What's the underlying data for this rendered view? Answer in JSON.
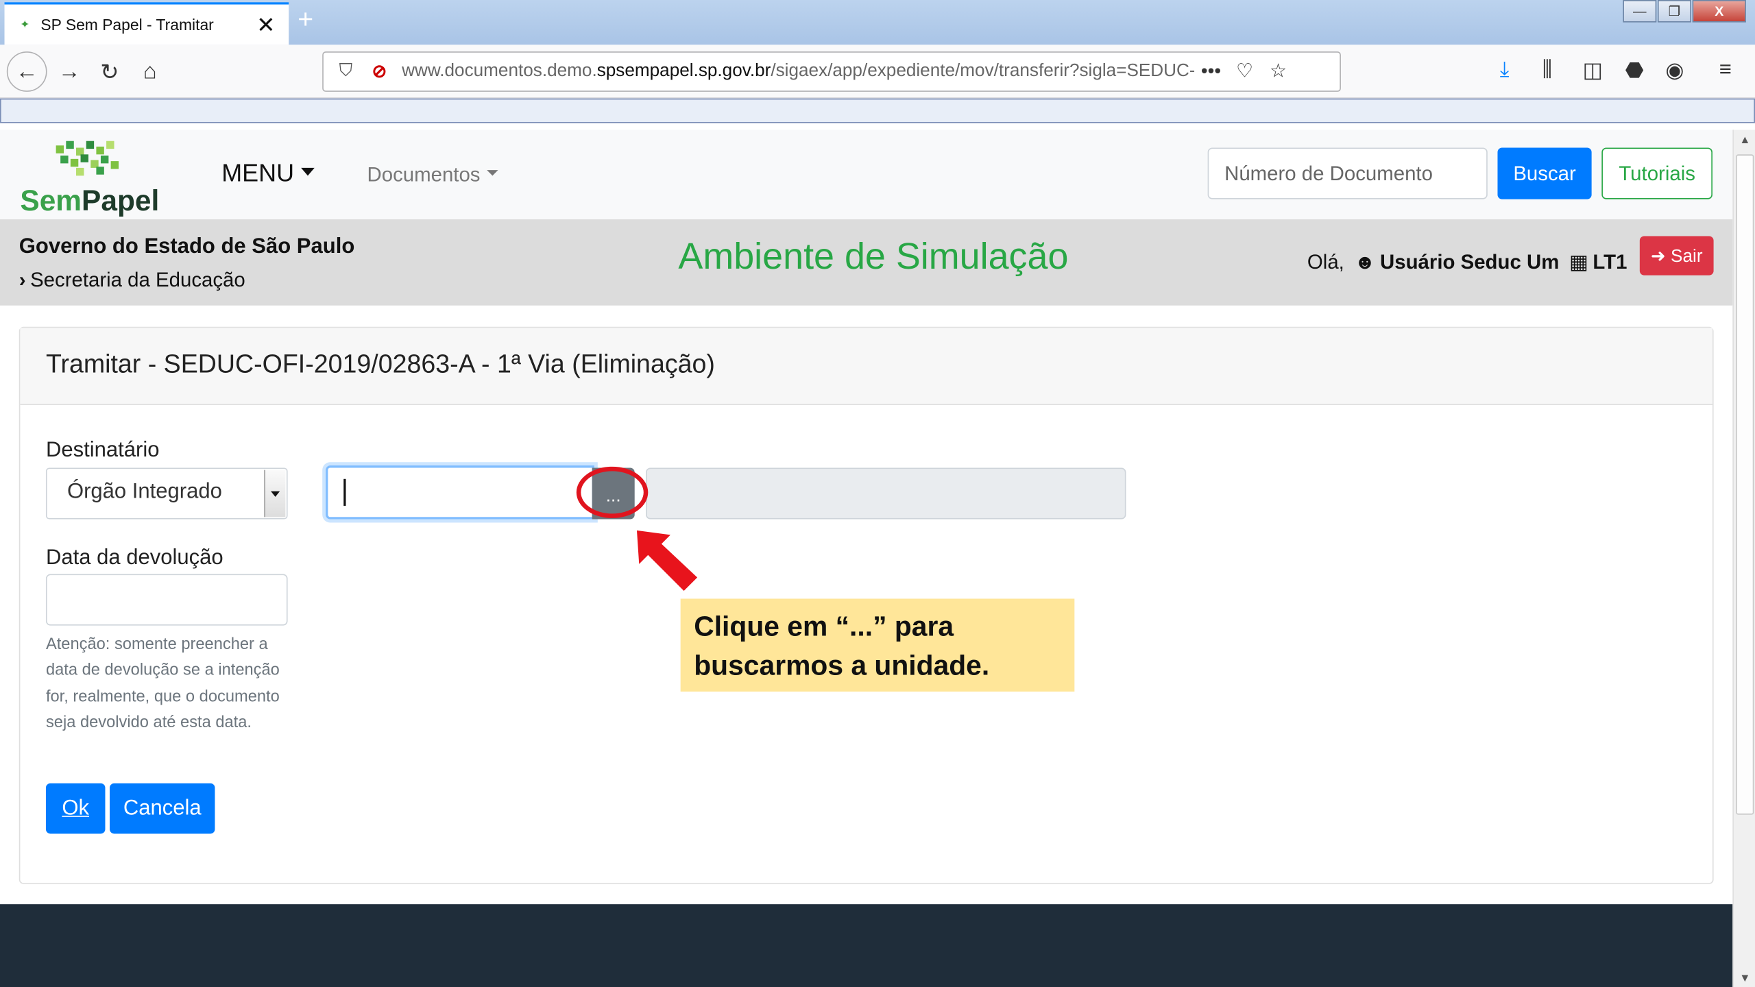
{
  "browser": {
    "tab_title": "SP Sem Papel - Tramitar",
    "tab_close": "✕",
    "new_tab": "+",
    "url_prefix": "www.documentos.demo.",
    "url_domain": "spsempapel.sp.gov.br",
    "url_path": "/sigaex/app/expediente/mov/transferir?sigla=SEDUC-O",
    "window_buttons": [
      "—",
      "❐",
      "X"
    ]
  },
  "site": {
    "logo_text_a": "Sem",
    "logo_text_b": "Papel",
    "menu_label": "MENU",
    "documents_label": "Documentos",
    "search_placeholder": "Número de Documento",
    "search_button": "Buscar",
    "tutorials_button": "Tutoriais"
  },
  "org": {
    "government": "Governo do Estado de São Paulo",
    "department": "Secretaria da Educação",
    "environment_title": "Ambiente de Simulação",
    "greeting": "Olá,",
    "user_name": "Usuário Seduc Um",
    "unit": "LT1",
    "logout_button": "Sair"
  },
  "form": {
    "title": "Tramitar - SEDUC-OFI-2019/02863-A - 1ª Via (Eliminação)",
    "recipient_label": "Destinatário",
    "recipient_type": "Órgão Integrado",
    "recipient_value": "",
    "search_unit_button": "...",
    "return_date_label": "Data da devolução",
    "return_date_value": "",
    "note": "Atenção: somente preencher a data de devolução se a intenção for, realmente, que o documento seja devolvido até esta data.",
    "ok_button": "Ok",
    "cancel_button": "Cancela"
  },
  "annotation": {
    "callout_line1": "Clique em “...” para",
    "callout_line2": "buscarmos a unidade.",
    "highlight_color": "#e0141e",
    "callout_bg": "#ffe699"
  },
  "colors": {
    "primary": "#007bff",
    "success": "#28a745",
    "danger": "#dc3545",
    "footer": "#1f2d3a"
  }
}
